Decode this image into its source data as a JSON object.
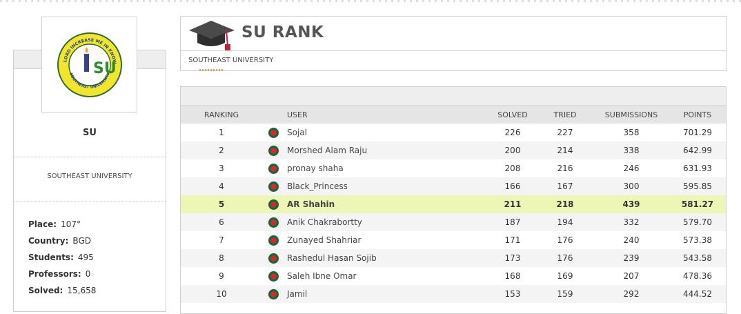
{
  "page": {
    "title": "SU RANK",
    "university_name": "SOUTHEAST UNIVERSITY"
  },
  "sidebar": {
    "acronym": "SU",
    "university_name": "SOUTHEAST UNIVERSITY",
    "logo": {
      "ring_text": "OH MY LORD INCREASE ME IN KNOWLEDGE",
      "bottom_text": "SOUTHEAST UNIVERSITY",
      "monogram": "SU"
    },
    "stats": [
      {
        "label": "Place:",
        "value": "107°"
      },
      {
        "label": "Country:",
        "value": "BGD"
      },
      {
        "label": "Students:",
        "value": "495"
      },
      {
        "label": "Professors:",
        "value": "0"
      },
      {
        "label": "Solved:",
        "value": "15,658"
      }
    ]
  },
  "table": {
    "headers": {
      "ranking": "RANKING",
      "user": "USER",
      "solved": "SOLVED",
      "tried": "TRIED",
      "submissions": "SUBMISSIONS",
      "points": "POINTS"
    },
    "rows": [
      {
        "rank": "1",
        "user": "Sojal",
        "solved": "226",
        "tried": "227",
        "submissions": "358",
        "points": "701.29"
      },
      {
        "rank": "2",
        "user": "Morshed Alam Raju",
        "solved": "200",
        "tried": "214",
        "submissions": "338",
        "points": "642.99"
      },
      {
        "rank": "3",
        "user": "pronay shaha",
        "solved": "208",
        "tried": "216",
        "submissions": "246",
        "points": "631.93"
      },
      {
        "rank": "4",
        "user": "Black_Princess",
        "solved": "166",
        "tried": "167",
        "submissions": "300",
        "points": "595.85"
      },
      {
        "rank": "5",
        "user": "AR Shahin",
        "solved": "211",
        "tried": "218",
        "submissions": "439",
        "points": "581.27"
      },
      {
        "rank": "6",
        "user": "Anik Chakrabortty",
        "solved": "187",
        "tried": "194",
        "submissions": "332",
        "points": "579.70"
      },
      {
        "rank": "7",
        "user": "Zunayed Shahriar",
        "solved": "171",
        "tried": "176",
        "submissions": "240",
        "points": "573.38"
      },
      {
        "rank": "8",
        "user": "Rashedul Hasan Sojib",
        "solved": "173",
        "tried": "176",
        "submissions": "239",
        "points": "543.58"
      },
      {
        "rank": "9",
        "user": "Saleh Ibne Omar",
        "solved": "168",
        "tried": "169",
        "submissions": "207",
        "points": "478.36"
      },
      {
        "rank": "10",
        "user": "Jamil",
        "solved": "153",
        "tried": "159",
        "submissions": "292",
        "points": "444.52"
      }
    ],
    "highlighted_rank": "5",
    "flag_icon": "bangladesh-flag-icon",
    "colors": {
      "highlight_row": "#eef6b6",
      "flag_green": "#0a6b3c",
      "flag_red": "#d7262c"
    }
  }
}
